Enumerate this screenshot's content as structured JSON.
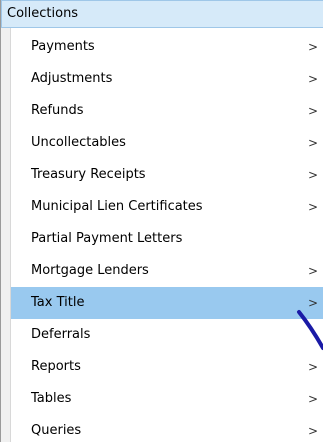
{
  "menu": {
    "title": "Collections",
    "selected_index": 8,
    "colors": {
      "header_bg": "#d6eaf9",
      "selected_bg": "#99c9ef",
      "annotation_stroke": "#1a1aa6"
    },
    "items": [
      {
        "label": "Payments",
        "has_submenu": true
      },
      {
        "label": "Adjustments",
        "has_submenu": true
      },
      {
        "label": "Refunds",
        "has_submenu": true
      },
      {
        "label": "Uncollectables",
        "has_submenu": true
      },
      {
        "label": "Treasury Receipts",
        "has_submenu": true
      },
      {
        "label": "Municipal Lien Certificates",
        "has_submenu": true
      },
      {
        "label": "Partial Payment Letters",
        "has_submenu": false
      },
      {
        "label": "Mortgage Lenders",
        "has_submenu": true
      },
      {
        "label": "Tax Title",
        "has_submenu": true
      },
      {
        "label": "Deferrals",
        "has_submenu": false
      },
      {
        "label": "Reports",
        "has_submenu": true
      },
      {
        "label": "Tables",
        "has_submenu": true
      },
      {
        "label": "Queries",
        "has_submenu": true
      }
    ],
    "submenu_icon": "chevron-right-icon",
    "submenu_glyph": ">"
  }
}
